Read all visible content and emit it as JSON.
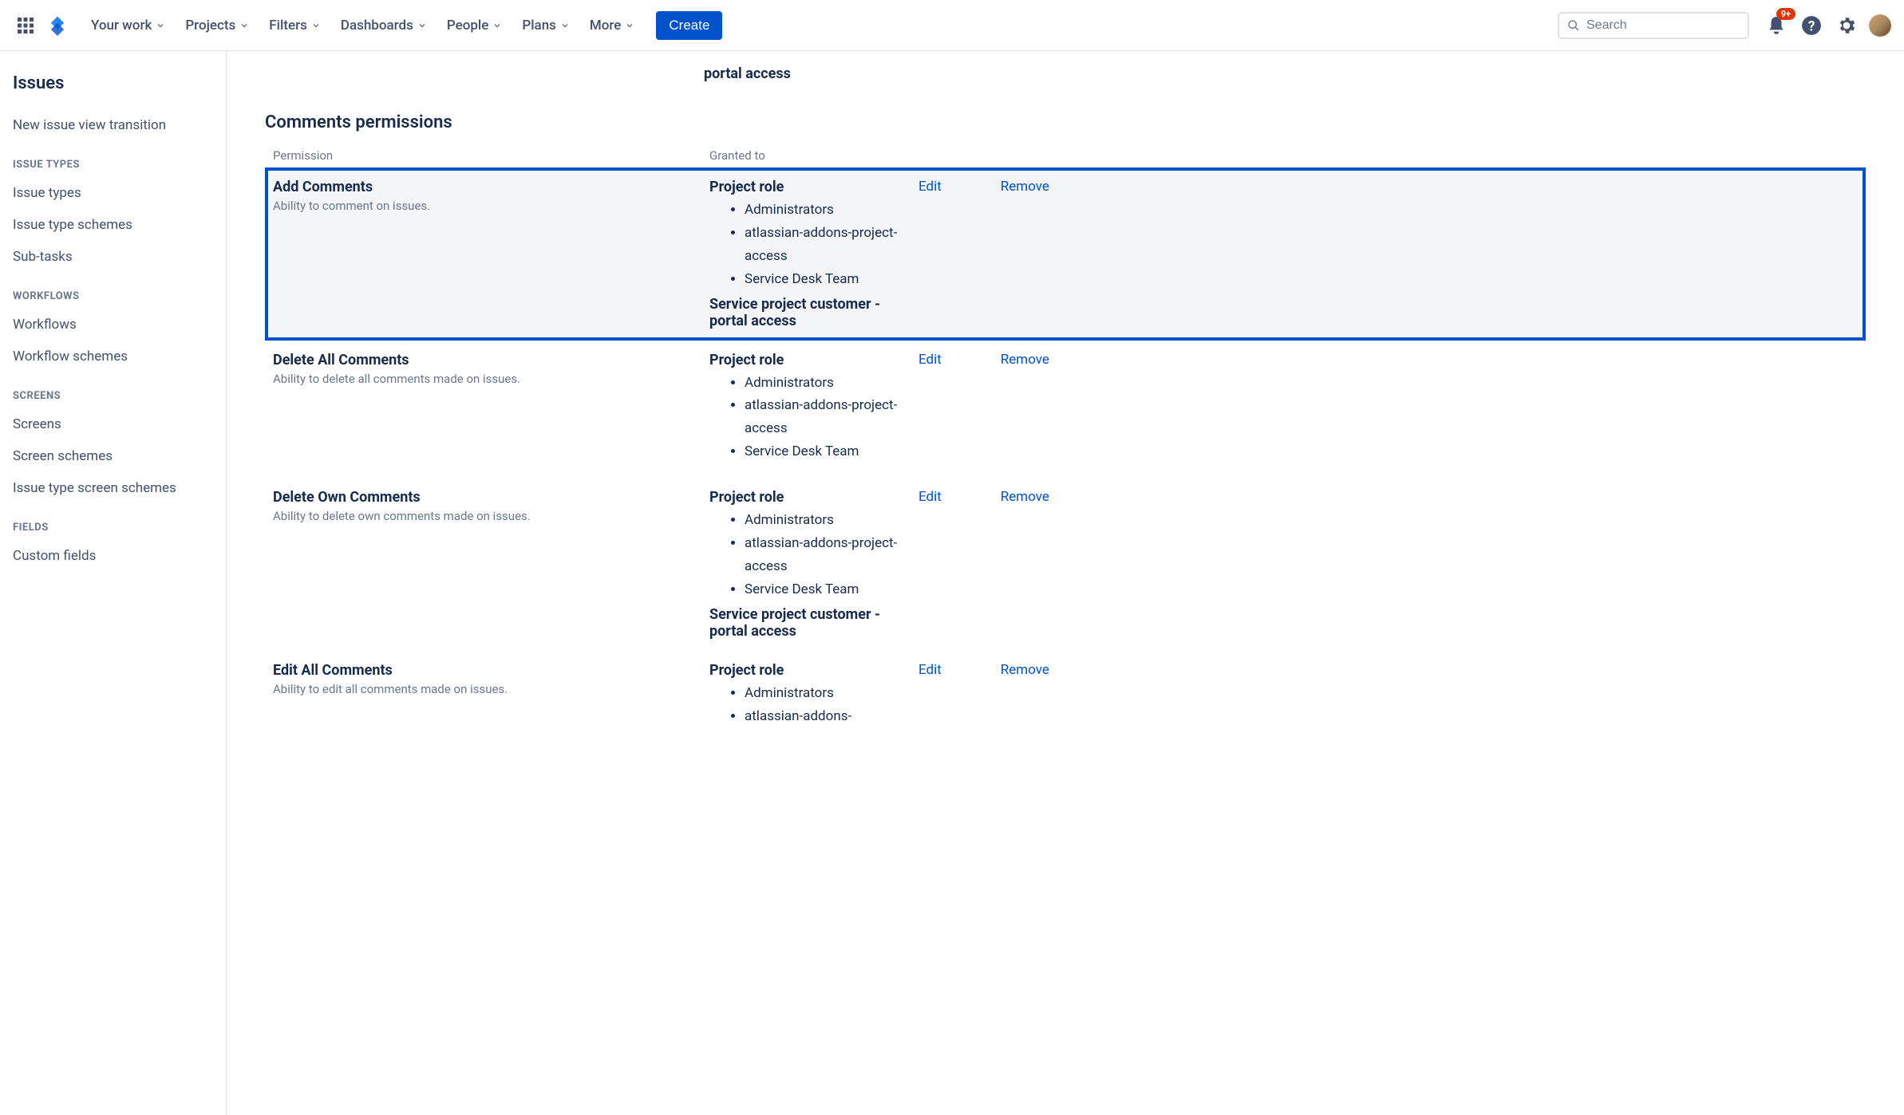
{
  "nav": {
    "items": [
      "Your work",
      "Projects",
      "Filters",
      "Dashboards",
      "People",
      "Plans",
      "More"
    ],
    "create": "Create",
    "search_placeholder": "Search",
    "badge": "9+"
  },
  "sidebar": {
    "title": "Issues",
    "links_top": [
      "New issue view transition"
    ],
    "sections": [
      {
        "heading": "ISSUE TYPES",
        "links": [
          "Issue types",
          "Issue type schemes",
          "Sub-tasks"
        ]
      },
      {
        "heading": "WORKFLOWS",
        "links": [
          "Workflows",
          "Workflow schemes"
        ]
      },
      {
        "heading": "SCREENS",
        "links": [
          "Screens",
          "Screen schemes",
          "Issue type screen schemes"
        ]
      },
      {
        "heading": "FIELDS",
        "links": [
          "Custom fields"
        ]
      }
    ]
  },
  "content": {
    "top_fragment": "portal access",
    "section_title": "Comments permissions",
    "header_perm": "Permission",
    "header_granted": "Granted to",
    "action_edit": "Edit",
    "action_remove": "Remove",
    "project_role_label": "Project role",
    "service_customer": "Service project customer - portal access",
    "roles": [
      "Administrators",
      "atlassian-addons-project-access",
      "Service Desk Team"
    ],
    "permissions": [
      {
        "name": "Add Comments",
        "desc": "Ability to comment on issues.",
        "highlighted": true,
        "show_service_customer": true
      },
      {
        "name": "Delete All Comments",
        "desc": "Ability to delete all comments made on issues.",
        "highlighted": false,
        "show_service_customer": false
      },
      {
        "name": "Delete Own Comments",
        "desc": "Ability to delete own comments made on issues.",
        "highlighted": false,
        "show_service_customer": true
      },
      {
        "name": "Edit All Comments",
        "desc": "Ability to edit all comments made on issues.",
        "highlighted": false,
        "show_service_customer": false,
        "partial_roles": [
          "Administrators",
          "atlassian-addons-"
        ]
      }
    ]
  }
}
